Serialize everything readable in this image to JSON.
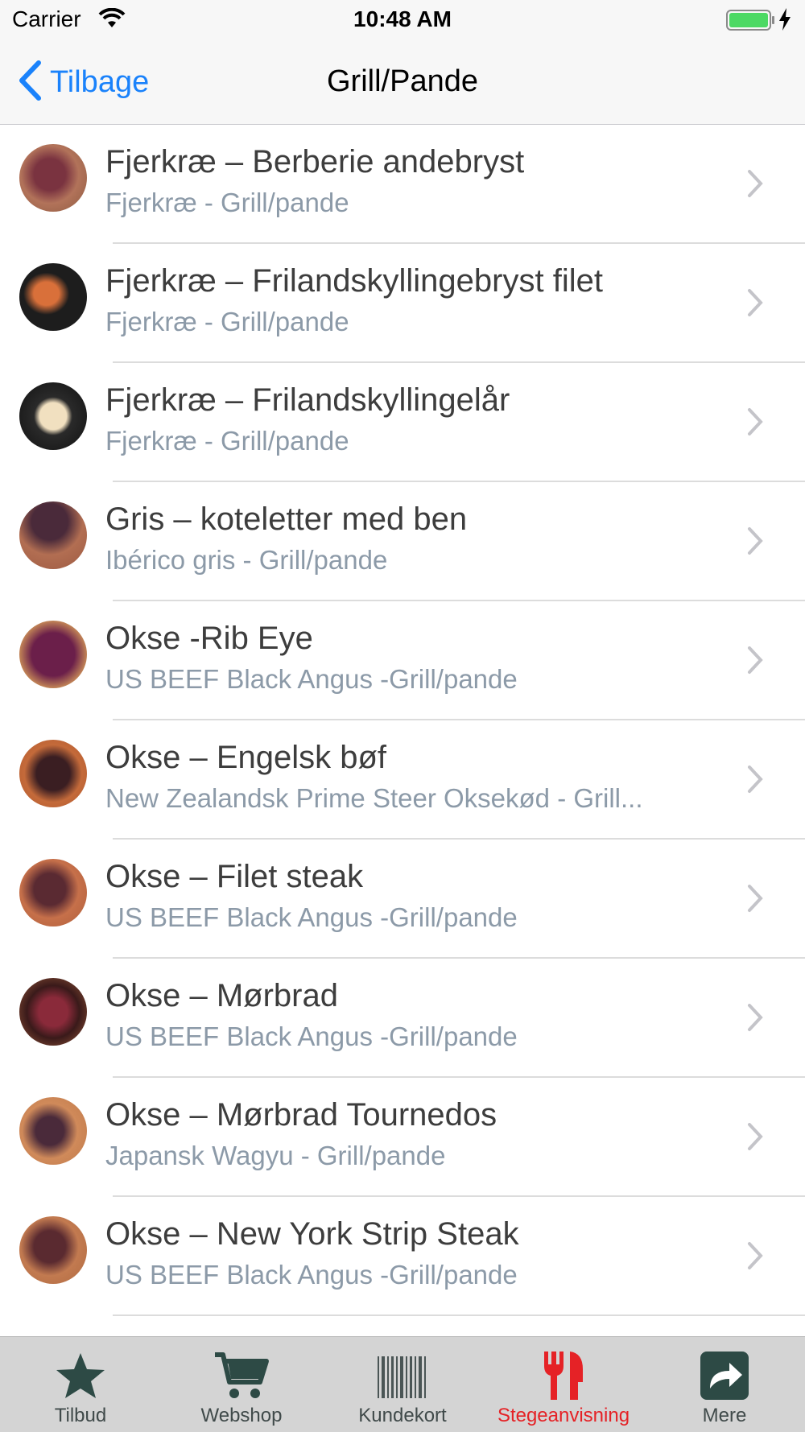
{
  "status_bar": {
    "carrier": "Carrier",
    "time": "10:48 AM"
  },
  "nav": {
    "back_label": "Tilbage",
    "title": "Grill/Pande"
  },
  "items": [
    {
      "title": "Fjerkræ – Berberie andebryst",
      "subtitle": "Fjerkræ - Grill/pande"
    },
    {
      "title": "Fjerkræ – Frilandskyllingebryst filet",
      "subtitle": "Fjerkræ - Grill/pande"
    },
    {
      "title": "Fjerkræ – Frilandskyllingelår",
      "subtitle": "Fjerkræ - Grill/pande"
    },
    {
      "title": "Gris – koteletter med ben",
      "subtitle": "Ibérico gris - Grill/pande"
    },
    {
      "title": "Okse -Rib Eye",
      "subtitle": "US BEEF Black Angus -Grill/pande"
    },
    {
      "title": "Okse – Engelsk bøf",
      "subtitle": "New Zealandsk Prime Steer Oksekød - Grill..."
    },
    {
      "title": "Okse – Filet steak",
      "subtitle": "US BEEF Black Angus -Grill/pande"
    },
    {
      "title": "Okse – Mørbrad",
      "subtitle": "US BEEF Black Angus -Grill/pande"
    },
    {
      "title": "Okse – Mørbrad Tournedos",
      "subtitle": "Japansk Wagyu - Grill/pande"
    },
    {
      "title": "Okse – New York Strip Steak",
      "subtitle": "US BEEF Black Angus -Grill/pande"
    }
  ],
  "tabs": [
    {
      "label": "Tilbud",
      "icon": "star-icon"
    },
    {
      "label": "Webshop",
      "icon": "cart-icon"
    },
    {
      "label": "Kundekort",
      "icon": "barcode-icon"
    },
    {
      "label": "Stegeanvisning",
      "icon": "fork-knife-icon",
      "active": true
    },
    {
      "label": "Mere",
      "icon": "share-arrow-icon"
    }
  ],
  "colors": {
    "accent": "#1a82fb",
    "active_tab": "#e52226",
    "tab_icon": "#2d4a45",
    "subtitle": "#8c9aa8"
  }
}
